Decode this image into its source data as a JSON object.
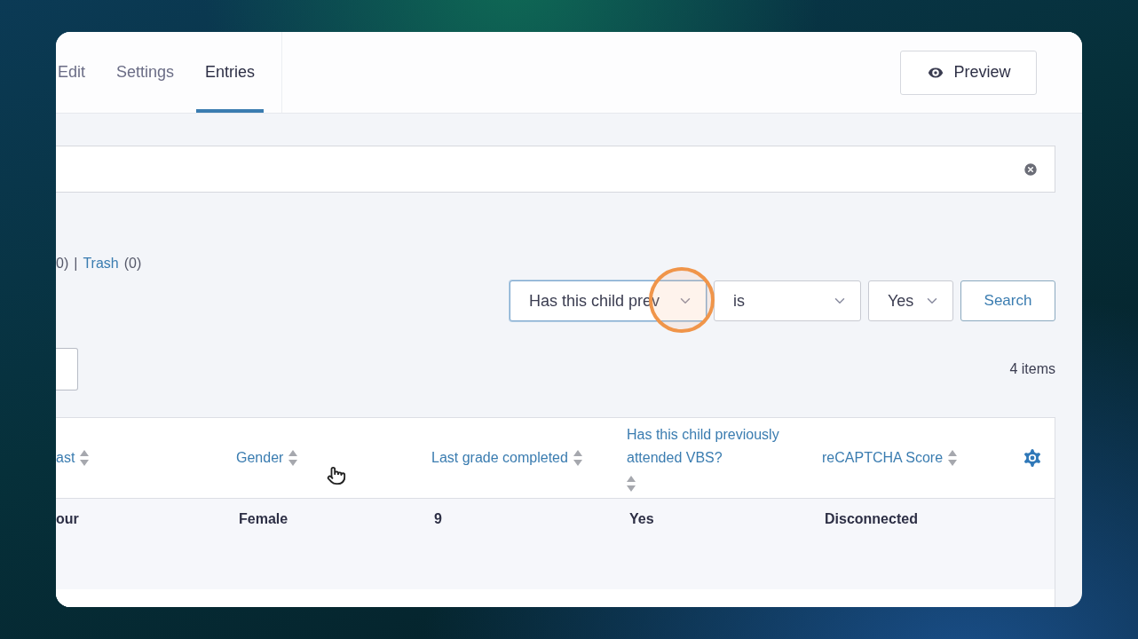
{
  "tabs": [
    {
      "label": "Edit",
      "selected": false
    },
    {
      "label": "Settings",
      "selected": false
    },
    {
      "label": "Entries",
      "selected": true
    }
  ],
  "preview_button": {
    "label": "Preview"
  },
  "status_links": [
    {
      "kind": "text",
      "text": "0)"
    },
    {
      "kind": "separator",
      "text": "|"
    },
    {
      "kind": "link",
      "text": "Trash"
    },
    {
      "kind": "text",
      "text": "(0)"
    }
  ],
  "filters": [
    {
      "value": "Has this child prev",
      "focused": true
    },
    {
      "value": "is",
      "focused": false
    },
    {
      "value": "Yes",
      "focused": false
    }
  ],
  "search_button": {
    "label": "Search"
  },
  "item_count": "4 items",
  "table": {
    "columns": [
      {
        "label": "ast"
      },
      {
        "label": "Gender"
      },
      {
        "label": "Last grade completed"
      },
      {
        "label": "Has this child previously attended VBS?"
      },
      {
        "label": "reCAPTCHA Score"
      }
    ],
    "rows": [
      {
        "cells": [
          "our",
          "Female",
          "9",
          "Yes",
          "Disconnected"
        ]
      }
    ]
  }
}
